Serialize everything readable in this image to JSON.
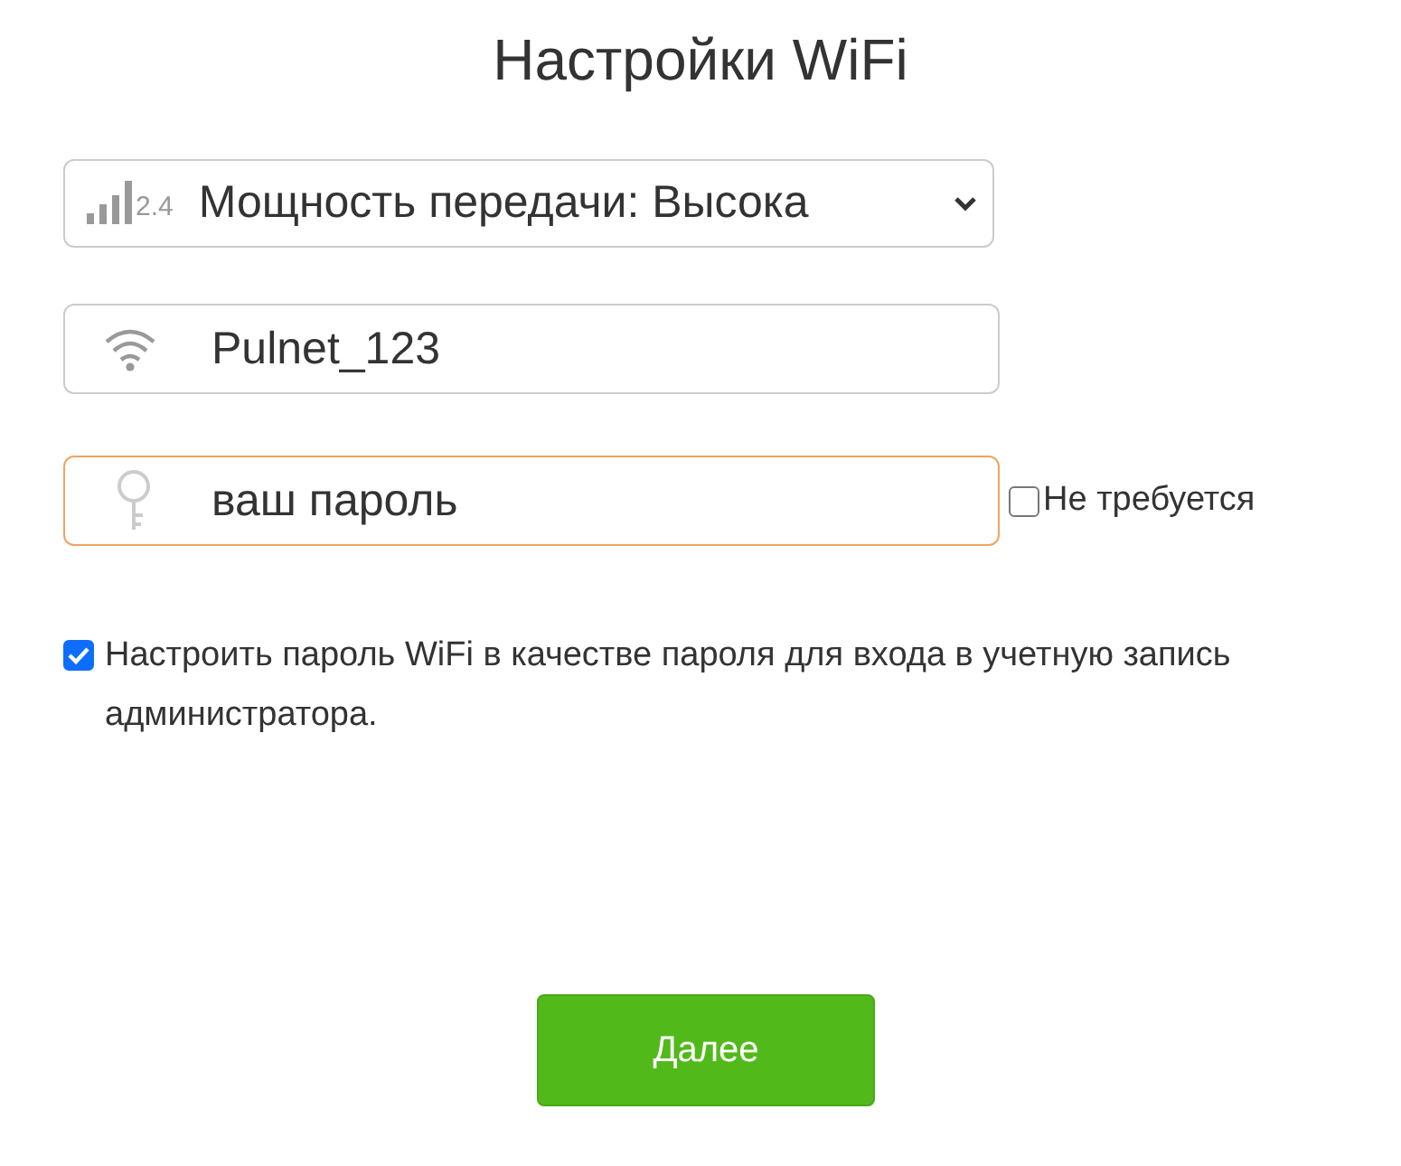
{
  "title": "Настройки WiFi",
  "power_select": {
    "band_label": "2.4",
    "value": "Мощность передачи: Высока"
  },
  "ssid_field": {
    "value": "Pulnet_123",
    "focused": false
  },
  "password_field": {
    "value": "ваш пароль",
    "focused": true
  },
  "no_password": {
    "label": "Не требуется",
    "checked": false
  },
  "admin_password": {
    "label": "Настроить пароль WiFi в качестве пароля для входа в учетную запись администратора.",
    "checked": true
  },
  "next_button": {
    "label": "Далее"
  }
}
